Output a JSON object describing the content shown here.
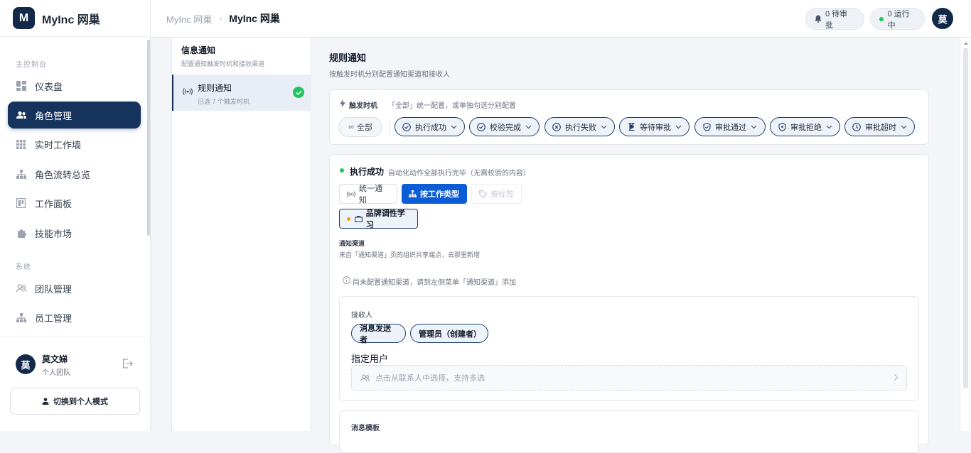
{
  "brand": {
    "logo_letter": "M",
    "name": "MyInc 网巢"
  },
  "sidebar": {
    "section_main": "主控制台",
    "section_system": "系统",
    "items": [
      {
        "label": "仪表盘",
        "icon": "dashboard-icon"
      },
      {
        "label": "角色管理",
        "icon": "users-icon",
        "active": true
      },
      {
        "label": "实时工作墙",
        "icon": "grid-icon"
      },
      {
        "label": "角色流转总览",
        "icon": "hierarchy-icon"
      },
      {
        "label": "工作面板",
        "icon": "board-icon"
      },
      {
        "label": "技能市场",
        "icon": "puzzle-icon"
      }
    ],
    "system_items": [
      {
        "label": "团队管理",
        "icon": "team-icon"
      },
      {
        "label": "员工管理",
        "icon": "hierarchy-icon"
      }
    ],
    "user": {
      "avatar": "莫",
      "name": "莫文娣",
      "team": "个人团队"
    },
    "switch_label": "切换到个人模式"
  },
  "topbar": {
    "breadcrumb": [
      "MyInc 网巢",
      "MyInc 网巢"
    ],
    "pending": "0 待审批",
    "running": "0 运行中",
    "avatar": "莫"
  },
  "left_panel": {
    "title": "信息通知",
    "subtitle": "配置通知触发时机和接收渠道",
    "item_title": "规则通知",
    "item_sub": "已选 7 个触发时机"
  },
  "main": {
    "title": "规则通知",
    "subtitle": "按触发时机分别配置通知渠道和接收人",
    "trigger": {
      "label": "触发时机",
      "hint": "「全部」统一配置，或单独勾选分别配置",
      "all_label": "全部",
      "chips": [
        {
          "label": "执行成功",
          "icon": "check-circle-icon"
        },
        {
          "label": "校验完成",
          "icon": "check-circle-icon"
        },
        {
          "label": "执行失败",
          "icon": "x-circle-icon"
        },
        {
          "label": "等待审批",
          "icon": "hourglass-icon"
        },
        {
          "label": "审批通过",
          "icon": "shield-check-icon"
        },
        {
          "label": "审批拒绝",
          "icon": "shield-x-icon"
        },
        {
          "label": "审批超时",
          "icon": "clock-icon"
        }
      ]
    },
    "event": {
      "title": "执行成功",
      "desc": "自动化动作全部执行完毕（无需校验的内容）",
      "status_color": "#22c55e",
      "modes": [
        "统一通知",
        "按工作类型",
        "按标签"
      ],
      "work_type": "品牌调性学习",
      "channel_title": "通知渠道",
      "channel_desc": "来自「通知渠道」页的组织共享端点，去那里新增",
      "channel_empty": "尚未配置通知渠道，请到左侧菜单「通知渠道」添加",
      "recipients_title": "接收人",
      "recipient_tags": [
        "消息发送者",
        "管理员（创建者）"
      ],
      "assign_title": "指定用户",
      "assign_placeholder": "点击从联系人中选择，支持多选",
      "template_title": "消息模板"
    }
  },
  "colors": {
    "brand": "#12294a",
    "accent": "#0b5cd5",
    "success": "#22c55e",
    "warning": "#f59e0b"
  }
}
